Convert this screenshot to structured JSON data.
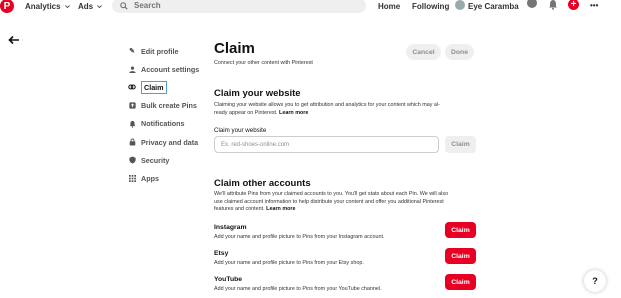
{
  "topbar": {
    "logo": "P",
    "analytics": "Analytics",
    "ads": "Ads",
    "search_placeholder": "Search",
    "home": "Home",
    "following": "Following",
    "username": "Eye Caramba",
    "more": "•••"
  },
  "sidebar": {
    "items": [
      {
        "label": "Edit profile",
        "icon": "pencil-icon"
      },
      {
        "label": "Account settings",
        "icon": "person-icon"
      },
      {
        "label": "Claim",
        "icon": "link-icon"
      },
      {
        "label": "Bulk create Pins",
        "icon": "upload-icon"
      },
      {
        "label": "Notifications",
        "icon": "bell-icon"
      },
      {
        "label": "Privacy and data",
        "icon": "lock-icon"
      },
      {
        "label": "Security",
        "icon": "shield-icon"
      },
      {
        "label": "Apps",
        "icon": "grid-icon"
      }
    ]
  },
  "main": {
    "title": "Claim",
    "subtitle": "Connect your other content with Pinterest",
    "cancel": "Cancel",
    "done": "Done",
    "website": {
      "heading": "Claim your website",
      "description_1": "Claiming your website allows you to get attribution and analytics for your content which may al-",
      "description_2": "ready appear on Pinterest.",
      "learn_more": "Learn more",
      "field_label": "Claim your website",
      "placeholder": "Ex. red-shoes-online.com",
      "button": "Claim"
    },
    "accounts": {
      "heading": "Claim other accounts",
      "description_1": "We'll attribute Pins from your claimed accounts to you. You'll get stats about each Pin. We will also",
      "description_2": "use claimed account information to help distribute your content and offer you additional Pinterest",
      "description_3": "features and content.",
      "learn_more": "Learn more",
      "list": [
        {
          "name": "Instagram",
          "desc": "Add your name and profile picture to Pins from your Instagram account.",
          "button": "Claim"
        },
        {
          "name": "Etsy",
          "desc": "Add your name and profile picture to Pins from your Etsy shop.",
          "button": "Claim"
        },
        {
          "name": "YouTube",
          "desc": "Add your name and profile picture to Pins from your YouTube channel.",
          "button": "Claim"
        }
      ]
    }
  },
  "help": "?",
  "colors": {
    "brand": "#e60023",
    "button_gray": "#efefef",
    "focus_outline": "#5b9bd5"
  }
}
